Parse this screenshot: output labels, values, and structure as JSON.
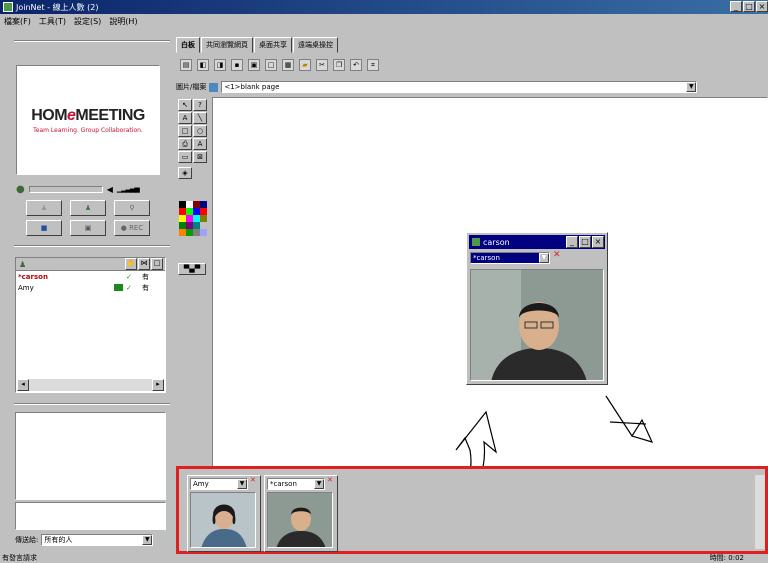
{
  "window": {
    "title": "JoinNet - 線上人數 (2)",
    "buttons": [
      "_",
      "□",
      "×"
    ]
  },
  "menu": [
    "檔案(F)",
    "工具(T)",
    "設定(S)",
    "說明(H)"
  ],
  "logo": {
    "brand_pre": "HOM",
    "brand_e": "e",
    "brand_post": "MEETING",
    "tagline": "Team Learning.  Group Collaboration."
  },
  "controls": {
    "rec_label": "● REC"
  },
  "users": {
    "rows": [
      {
        "name": "*carson",
        "check": "✓",
        "status": "有",
        "color": "#c00000"
      },
      {
        "name": "Amy",
        "check": "✓",
        "status": "有",
        "color": "#000000"
      }
    ]
  },
  "send": {
    "label": "傳送給:",
    "value": "所有的人"
  },
  "tabs": [
    "白板",
    "共同瀏覽網頁",
    "桌面共享",
    "遠端桌操控"
  ],
  "image_row": {
    "label": "圖片/檔案",
    "value": "<1>blank page"
  },
  "video_window": {
    "title": "carson",
    "selector": "*carson"
  },
  "thumbnails": [
    {
      "name": "Amy"
    },
    {
      "name": "*carson"
    }
  ],
  "status": {
    "left": "有發言請求",
    "right": "時間: 0:02"
  },
  "colors": {
    "accent_red": "#e02020",
    "titlebar": "#0a246a"
  }
}
